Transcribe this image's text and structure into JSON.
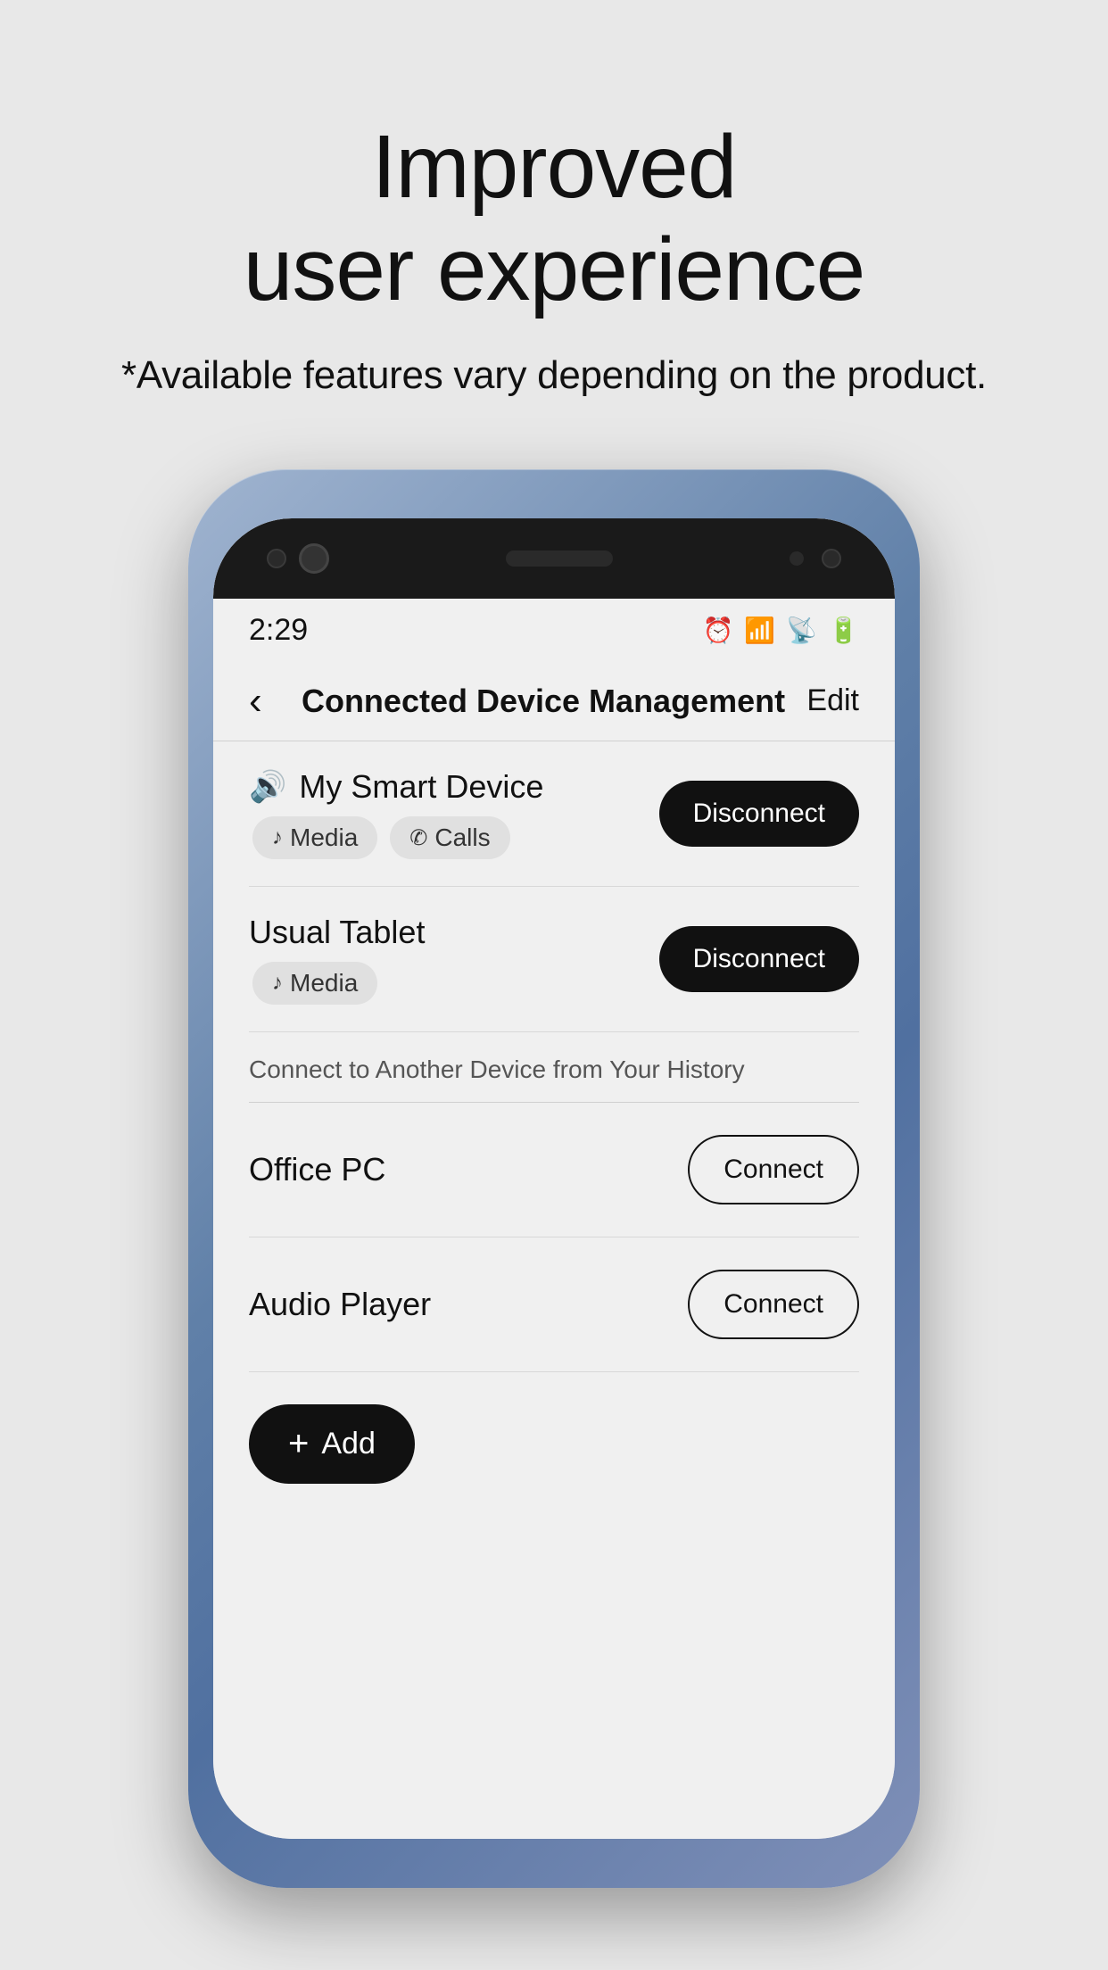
{
  "page": {
    "background": "#e8e8e8"
  },
  "hero": {
    "headline": "Improved\nuser experience",
    "subtitle": "*Available features vary depending on the product."
  },
  "status_bar": {
    "time": "2:29",
    "icons": [
      "⏰",
      "WiFi",
      "Signal",
      "Battery"
    ]
  },
  "nav": {
    "title": "Connected Device Management",
    "back_label": "‹",
    "edit_label": "Edit"
  },
  "connected_devices": [
    {
      "name": "My Smart Device",
      "icon": "🔊",
      "tags": [
        {
          "icon": "♪",
          "label": "Media"
        },
        {
          "icon": "✆",
          "label": "Calls"
        }
      ],
      "action": "Disconnect"
    },
    {
      "name": "Usual Tablet",
      "icon": "",
      "tags": [
        {
          "icon": "♪",
          "label": "Media"
        }
      ],
      "action": "Disconnect"
    }
  ],
  "history_section": {
    "header": "Connect to Another Device from Your History",
    "devices": [
      {
        "name": "Office PC",
        "action": "Connect"
      },
      {
        "name": "Audio Player",
        "action": "Connect"
      }
    ]
  },
  "add_button": {
    "label": "Add",
    "plus": "+"
  }
}
